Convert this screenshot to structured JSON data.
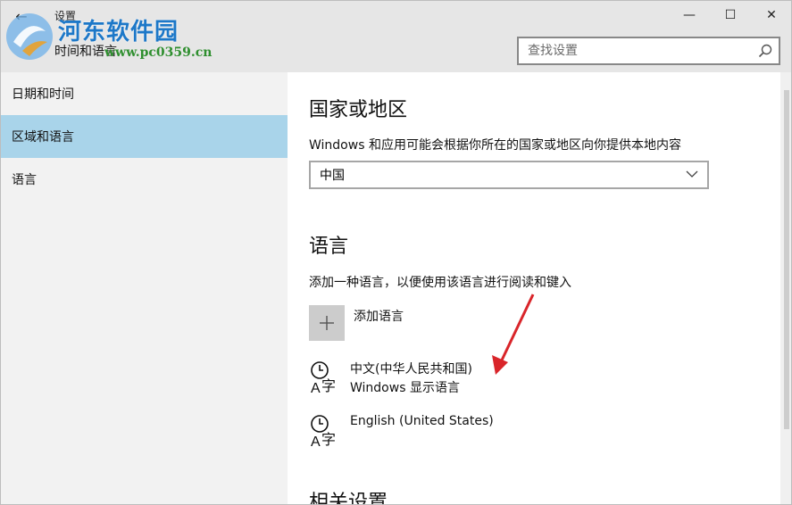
{
  "window": {
    "app_title": "设置",
    "page_heading": "时间和语言",
    "minimize_glyph": "—",
    "maximize_glyph": "☐",
    "close_glyph": "✕",
    "back_glyph": "←"
  },
  "search": {
    "placeholder": "查找设置",
    "icon": "search-icon"
  },
  "watermark": {
    "brand": "河东软件园",
    "url": "www.pc0359.cn"
  },
  "sidebar": {
    "items": [
      {
        "label": "日期和时间",
        "active": false
      },
      {
        "label": "区域和语言",
        "active": true
      },
      {
        "label": "语言",
        "active": false
      }
    ]
  },
  "region": {
    "title": "国家或地区",
    "description": "Windows 和应用可能会根据你所在的国家或地区向你提供本地内容",
    "selected": "中国"
  },
  "language": {
    "title": "语言",
    "description": "添加一种语言，以便使用该语言进行阅读和键入",
    "add_label": "添加语言",
    "entries": [
      {
        "name": "中文(中华人民共和国)",
        "sub": "Windows 显示语言"
      },
      {
        "name": "English (United States)",
        "sub": ""
      }
    ]
  },
  "related": {
    "title": "相关设置"
  },
  "colors": {
    "titlebar_bg": "#e6e6e6",
    "sidebar_bg": "#f2f2f2",
    "active_item_bg": "#a9d4ea",
    "annotation_arrow": "#d9252a",
    "watermark_blue": "#1d78c8",
    "watermark_green": "#2f8f2f"
  }
}
